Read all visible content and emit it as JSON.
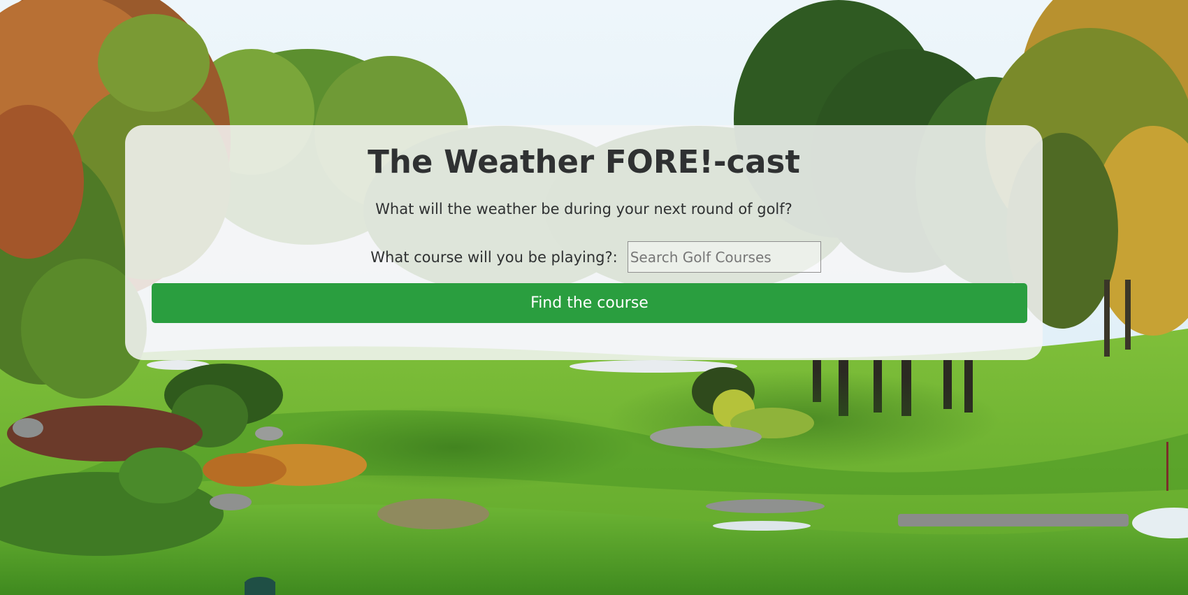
{
  "header": {
    "title": "The Weather FORE!-cast",
    "subtitle": "What will the weather be during your next round of golf?"
  },
  "search": {
    "label": "What course will you be playing?:",
    "placeholder": "Search Golf Courses",
    "value": ""
  },
  "actions": {
    "find_label": "Find the course"
  },
  "colors": {
    "button": "#2a9e3f",
    "text": "#2f3132",
    "card": "#f6f6f7"
  }
}
